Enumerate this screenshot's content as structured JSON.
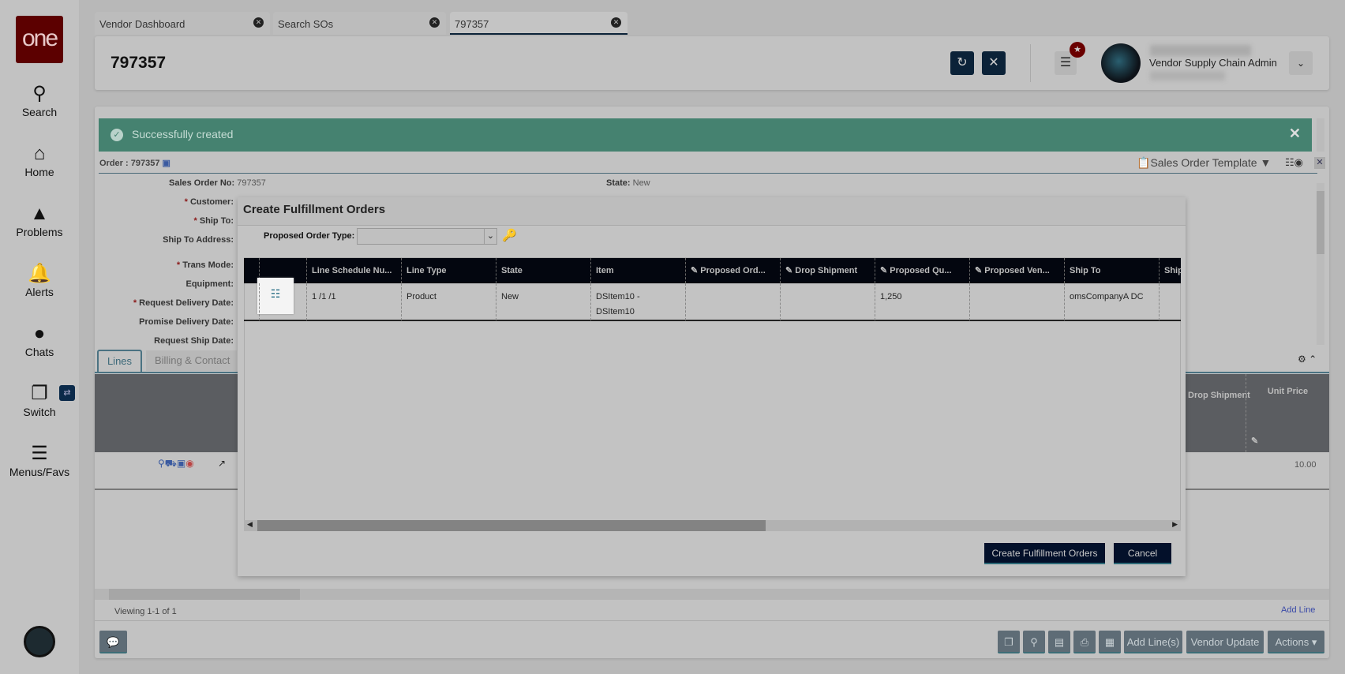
{
  "sidebar": {
    "logo": "one",
    "items": [
      {
        "label": "Search",
        "icon": "search-icon"
      },
      {
        "label": "Home",
        "icon": "home-icon"
      },
      {
        "label": "Problems",
        "icon": "warning-icon"
      },
      {
        "label": "Alerts",
        "icon": "bell-icon"
      },
      {
        "label": "Chats",
        "icon": "chat-icon"
      },
      {
        "label": "Switch",
        "icon": "switch-icon"
      },
      {
        "label": "Menus/Favs",
        "icon": "menu-icon"
      }
    ]
  },
  "tabs": [
    {
      "label": "Vendor Dashboard"
    },
    {
      "label": "Search SOs"
    },
    {
      "label": "797357",
      "active": true
    }
  ],
  "header": {
    "title": "797357",
    "user_role": "Vendor Supply Chain Admin"
  },
  "banner": {
    "message": "Successfully created",
    "color": "#458270"
  },
  "order": {
    "label": "Order : 797357",
    "template": "Sales Order Template"
  },
  "form": {
    "sales_order_no_label": "Sales Order No:",
    "sales_order_no": "797357",
    "state_label": "State:",
    "state": "New",
    "customer": "Customer:",
    "ship_to": "Ship To:",
    "ship_to_address": "Ship To Address:",
    "trans_mode": "Trans Mode:",
    "equipment": "Equipment:",
    "request_delivery_date": "Request Delivery Date:",
    "promise_delivery_date": "Promise Delivery Date:",
    "request_ship_date": "Request Ship Date:"
  },
  "lines_tabs": [
    "Lines",
    "Billing & Contact"
  ],
  "lines_grid": {
    "headers": {
      "drop_shipment": "Drop Shipment",
      "unit_price": "Unit Price"
    },
    "row": {
      "unit_price": "10.00"
    }
  },
  "footer": {
    "viewing": "Viewing 1-1 of 1",
    "add_line": "Add Line",
    "buttons": [
      "Add Line(s)",
      "Vendor Update",
      "Actions"
    ]
  },
  "modal": {
    "title": "Create Fulfillment Orders",
    "order_type_label": "Proposed Order Type:",
    "order_type_value": "",
    "columns": [
      "Line Schedule Nu...",
      "Line Type",
      "State",
      "Item",
      "Proposed Ord...",
      "Drop Shipment",
      "Proposed Qu...",
      "Proposed Ven...",
      "Ship To",
      "Ship"
    ],
    "rows": [
      {
        "line_schedule": "1 /1 /1",
        "line_type": "Product",
        "state": "New",
        "item": "DSItem10 - DSItem10",
        "proposed_order": "",
        "drop_shipment": "",
        "proposed_qty": "1,250",
        "proposed_vendor": "",
        "ship_to": "omsCompanyA DC",
        "ship": ""
      }
    ],
    "create_button": "Create Fulfillment Orders",
    "cancel_button": "Cancel"
  }
}
